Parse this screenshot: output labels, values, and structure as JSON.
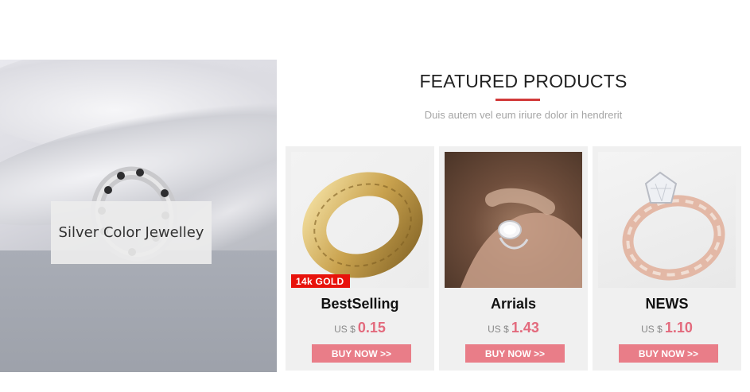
{
  "hero": {
    "caption": "Silver Color Jewelley"
  },
  "section": {
    "title": "FEATURED PRODUCTS",
    "subtitle": "Duis autem vel eum iriure dolor in hendrerit",
    "accent_color": "#d23a3a"
  },
  "products": [
    {
      "name": "BestSelling",
      "currency": "US $",
      "price": "0.15",
      "badge": "14k GOLD",
      "button": "BUY NOW >>",
      "image": "gold-engraved-ring"
    },
    {
      "name": "Arrials",
      "currency": "US $",
      "price": "1.43",
      "button": "BUY NOW >>",
      "image": "hand-wearing-oval-diamond-ring"
    },
    {
      "name": "NEWS",
      "currency": "US $",
      "price": "1.10",
      "button": "BUY NOW >>",
      "image": "rose-gold-twisted-ring"
    }
  ],
  "colors": {
    "button": "#e97d88",
    "price": "#e36a7d",
    "badge": "#e8130c"
  }
}
